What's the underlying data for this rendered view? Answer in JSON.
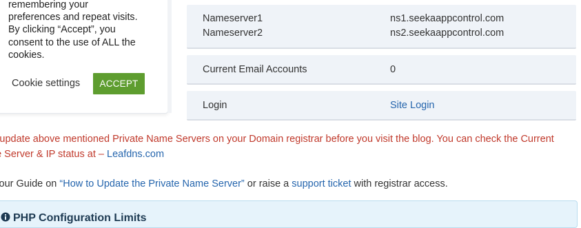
{
  "cookie": {
    "text_lines": [
      "remembering your",
      "preferences and repeat visits.",
      "By clicking “Accept”, you",
      "consent to the use of ALL the",
      "cookies."
    ],
    "settings_label": "Cookie settings",
    "accept_label": "ACCEPT"
  },
  "server_info": {
    "nameserver1_label": "Nameserver1",
    "nameserver1_value": "ns1.seekaappcontrol.com",
    "nameserver2_label": "Nameserver2",
    "nameserver2_value": "ns2.seekaappcontrol.com",
    "email_label": "Current Email Accounts",
    "email_value": "0",
    "login_label": "Login",
    "login_value": "Site Login"
  },
  "notice": {
    "line1": "ase update above mentioned Private Name Servers on your Domain registrar before you visit the blog. You can check the Current",
    "line2_prefix": "ne Server & IP status at – ",
    "line2_link": "Leafdns.com"
  },
  "guide": {
    "prefix": "ck our Guide on ",
    "guide_link": "“How to Update the Private Name Server”",
    "middle": " or raise a ",
    "ticket_link": "support ticket",
    "suffix": " with registrar access."
  },
  "php_panel": {
    "title": "PHP Configuration Limits",
    "icon": "info-icon"
  },
  "colors": {
    "accept_bg": "#5e9d2f",
    "link": "#2565ad",
    "notice": "#c0392b",
    "row_bg": "#eff3f8",
    "panel_bg": "#e6f3fb"
  }
}
